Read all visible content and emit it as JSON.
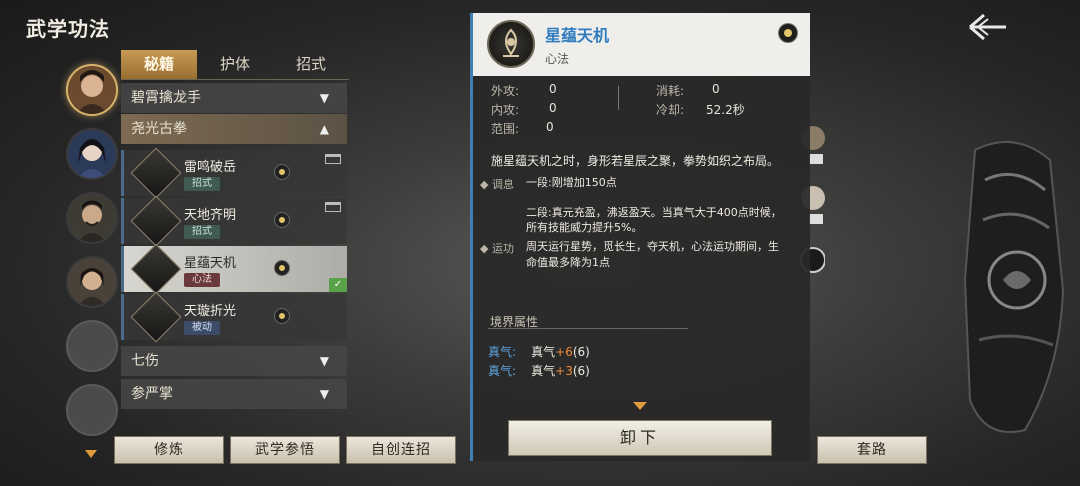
{
  "title": "武学功法",
  "tabs": [
    "秘籍",
    "护体",
    "招式"
  ],
  "active_tab": 0,
  "categories": {
    "c1": "碧霄擒龙手",
    "c2": "尧光古拳",
    "c3": "七伤",
    "c4": "参严掌"
  },
  "skills": [
    {
      "name": "雷鸣破岳",
      "type": "招式"
    },
    {
      "name": "天地齐明",
      "type": "招式"
    },
    {
      "name": "星蕴天机",
      "type": "心法"
    },
    {
      "name": "天璇折光",
      "type": "被动"
    }
  ],
  "bottom_buttons": [
    "修炼",
    "武学参悟",
    "自创连招",
    "套路"
  ],
  "detail": {
    "name": "星蕴天机",
    "type": "心法",
    "stats": {
      "outer_label": "外攻:",
      "outer_value": "0",
      "inner_label": "内攻:",
      "inner_value": "0",
      "range_label": "范围:",
      "range_value": "0",
      "cost_label": "消耗:",
      "cost_value": "0",
      "cooldown_label": "冷却:",
      "cooldown_value": "52.2秒"
    },
    "description": "施星蕴天机之时，身形若星辰之聚，拳势如织之布局。",
    "bullets": [
      {
        "tag": "调息",
        "lines": [
          "一段:刚增加150点",
          "二段:真元充盈，沸返盈天。当真气大于400点时候，",
          "所有技能威力提升5%。"
        ]
      },
      {
        "tag": "运功",
        "lines": [
          "周天运行星势，觅长生，夺天机，心法运功期间，生",
          "命值最多降为1点"
        ]
      }
    ],
    "realm_title": "境界属性",
    "realm": [
      {
        "label": "真气:",
        "text": "真气",
        "bonus": "+6",
        "suffix": "(6)"
      },
      {
        "label": "真气:",
        "text": "真气",
        "bonus": "+3",
        "suffix": "(6)"
      }
    ],
    "unequip_label": "卸下"
  },
  "colors": {
    "accent_blue": "#3f7fb6",
    "tab_active": "#c79a55",
    "bonus_orange": "#f08a3a"
  }
}
